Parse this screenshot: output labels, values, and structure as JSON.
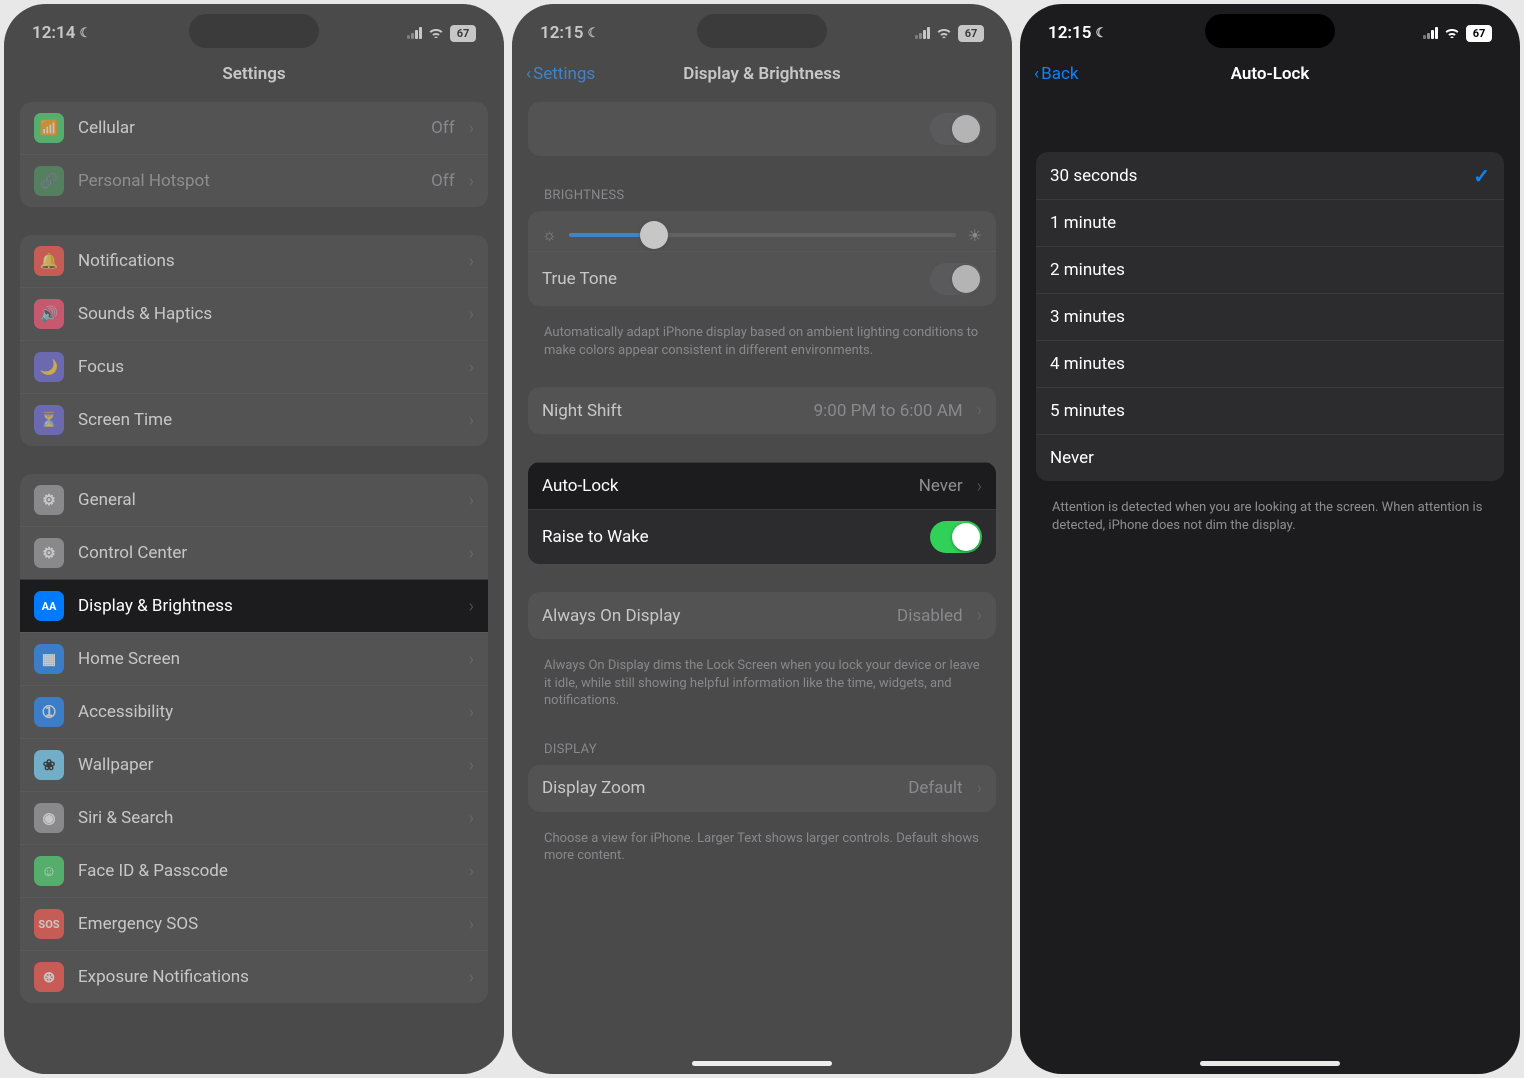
{
  "phone1": {
    "status": {
      "time": "12:14",
      "battery": "67"
    },
    "nav": {
      "title": "Settings"
    },
    "groups": [
      [
        {
          "icon": "antenna",
          "color": "ic-green",
          "label": "Cellular",
          "value": "Off"
        },
        {
          "icon": "link",
          "color": "ic-green disabled",
          "label": "Personal Hotspot",
          "value": "Off",
          "disabled": true
        }
      ],
      [
        {
          "icon": "bell",
          "color": "ic-red",
          "label": "Notifications"
        },
        {
          "icon": "speaker",
          "color": "ic-pink",
          "label": "Sounds & Haptics"
        },
        {
          "icon": "moon",
          "color": "ic-indigo",
          "label": "Focus"
        },
        {
          "icon": "hourglass",
          "color": "ic-indigo",
          "label": "Screen Time"
        }
      ],
      [
        {
          "icon": "gear",
          "color": "ic-gray",
          "label": "General"
        },
        {
          "icon": "switches",
          "color": "ic-gray",
          "label": "Control Center"
        },
        {
          "icon": "AA",
          "color": "ic-blue",
          "label": "Display & Brightness",
          "highlight": true
        },
        {
          "icon": "grid",
          "color": "ic-blue",
          "label": "Home Screen"
        },
        {
          "icon": "person",
          "color": "ic-blue",
          "label": "Accessibility"
        },
        {
          "icon": "flower",
          "color": "ic-cyan",
          "label": "Wallpaper"
        },
        {
          "icon": "siri",
          "color": "ic-gray",
          "label": "Siri & Search"
        },
        {
          "icon": "face",
          "color": "ic-green",
          "label": "Face ID & Passcode"
        },
        {
          "icon": "SOS",
          "color": "ic-red",
          "label": "Emergency SOS"
        },
        {
          "icon": "virus",
          "color": "ic-red",
          "label": "Exposure Notifications"
        }
      ]
    ]
  },
  "phone2": {
    "status": {
      "time": "12:15",
      "battery": "67"
    },
    "nav": {
      "back": "Settings",
      "title": "Display & Brightness"
    },
    "brightness_header": "BRIGHTNESS",
    "true_tone_label": "True Tone",
    "true_tone_footer": "Automatically adapt iPhone display based on ambient lighting conditions to make colors appear consistent in different environments.",
    "night_shift_label": "Night Shift",
    "night_shift_value": "9:00 PM to 6:00 AM",
    "auto_lock_label": "Auto-Lock",
    "auto_lock_value": "Never",
    "raise_label": "Raise to Wake",
    "aod_label": "Always On Display",
    "aod_value": "Disabled",
    "aod_footer": "Always On Display dims the Lock Screen when you lock your device or leave it idle, while still showing helpful information like the time, widgets, and notifications.",
    "display_header": "DISPLAY",
    "zoom_label": "Display Zoom",
    "zoom_value": "Default",
    "zoom_footer": "Choose a view for iPhone. Larger Text shows larger controls. Default shows more content."
  },
  "phone3": {
    "status": {
      "time": "12:15",
      "battery": "67"
    },
    "nav": {
      "back": "Back",
      "title": "Auto-Lock"
    },
    "options": [
      "30 seconds",
      "1 minute",
      "2 minutes",
      "3 minutes",
      "4 minutes",
      "5 minutes",
      "Never"
    ],
    "selected": 0,
    "footer": "Attention is detected when you are looking at the screen. When attention is detected, iPhone does not dim the display."
  }
}
